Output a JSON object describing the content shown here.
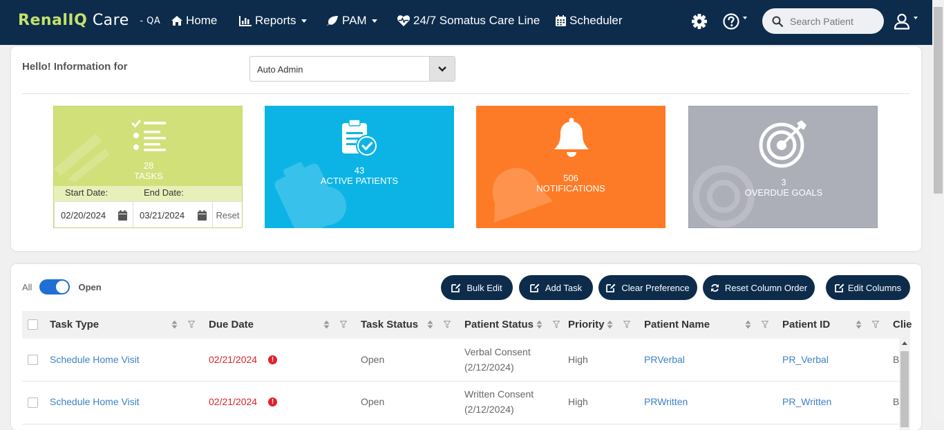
{
  "navbar": {
    "brand_part1": "RenalIQ",
    "brand_part2": "Care",
    "env": "- QA",
    "items": [
      {
        "label": "Home"
      },
      {
        "label": "Reports"
      },
      {
        "label": "PAM"
      },
      {
        "label": "24/7 Somatus Care Line"
      },
      {
        "label": "Scheduler"
      }
    ],
    "search_placeholder": "Search Patient",
    "colors": {
      "background": "#0d2c4c",
      "brand_accent": "#c5e26b"
    }
  },
  "header": {
    "greeting": "Hello! Information for",
    "selected_user": "Auto Admin"
  },
  "cards": {
    "tasks": {
      "count": "28",
      "label": "TASKS",
      "start_label": "Start Date:",
      "end_label": "End Date:",
      "start_date": "02/20/2024",
      "end_date": "03/21/2024",
      "reset_label": "Reset",
      "color": "#d2e079"
    },
    "patients": {
      "count": "43",
      "label": "ACTIVE PATIENTS",
      "color": "#0cb4e6"
    },
    "notifications": {
      "count": "506",
      "label": "NOTIFICATIONS",
      "color": "#fd7b26"
    },
    "goals": {
      "count": "3",
      "label": "OVERDUE GOALS",
      "color": "#acaeb8"
    }
  },
  "toolbar": {
    "toggle_all": "All",
    "toggle_open": "Open",
    "bulk_edit": "Bulk Edit",
    "add_task": "Add Task",
    "clear_preference": "Clear Preference",
    "reset_column_order": "Reset Column Order",
    "edit_columns": "Edit Columns"
  },
  "table": {
    "columns": [
      "Task Type",
      "Due Date",
      "Task Status",
      "Patient Status",
      "Priority",
      "Patient Name",
      "Patient ID",
      "Clie"
    ],
    "rows": [
      {
        "task_type": "Schedule Home Visit",
        "due_date": "02/21/2024",
        "task_status": "Open",
        "patient_status_1": "Verbal Consent",
        "patient_status_2": "(2/12/2024)",
        "priority": "High",
        "patient_name": "PRVerbal",
        "patient_id": "PR_Verbal",
        "client": "B"
      },
      {
        "task_type": "Schedule Home Visit",
        "due_date": "02/21/2024",
        "task_status": "Open",
        "patient_status_1": "Written Consent",
        "patient_status_2": "(2/12/2024)",
        "priority": "High",
        "patient_name": "PRWritten",
        "patient_id": "PR_Written",
        "client": "B"
      }
    ]
  }
}
